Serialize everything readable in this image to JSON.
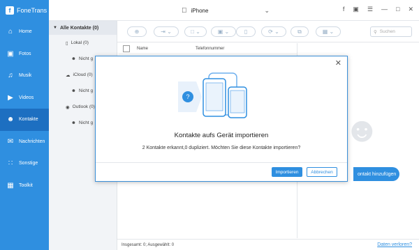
{
  "app": {
    "title": "FoneTrans"
  },
  "device": {
    "name": "iPhone"
  },
  "sidebar": {
    "items": [
      {
        "label": "Home",
        "icon": "home-icon"
      },
      {
        "label": "Fotos",
        "icon": "photo-icon"
      },
      {
        "label": "Musik",
        "icon": "music-icon"
      },
      {
        "label": "Videos",
        "icon": "video-icon"
      },
      {
        "label": "Kontakte",
        "icon": "contacts-icon",
        "active": true
      },
      {
        "label": "Nachrichten",
        "icon": "messages-icon"
      },
      {
        "label": "Sonstige",
        "icon": "other-icon"
      },
      {
        "label": "Toolkit",
        "icon": "toolkit-icon"
      }
    ]
  },
  "tree": {
    "header": "Alle Kontakte  (0)",
    "groups": [
      {
        "label": "Lokal  (0)",
        "child": "Nicht g"
      },
      {
        "label": "iCloud  (0)",
        "child": "Nicht g"
      },
      {
        "label": "Outlook  (0)",
        "child": "Nicht g"
      }
    ]
  },
  "search": {
    "placeholder": "Suchen"
  },
  "list": {
    "col_name": "Name",
    "col_phone": "Telefonnummer"
  },
  "detail": {
    "add_label": "ontakt hinzufügen"
  },
  "status": {
    "summary": "Insgesamt: 0; Ausgewählt: 0",
    "link": "Daten verloren?"
  },
  "modal": {
    "title": "Kontakte aufs Gerät importieren",
    "message": "2 Kontakte erkannt,0 dupliziert. Möchten Sie diese Kontakte importieren?",
    "import_label": "Importieren",
    "cancel_label": "Abbrechen"
  },
  "colors": {
    "accent": "#2f8fe0",
    "sidebar_active": "#1d6fc1"
  }
}
